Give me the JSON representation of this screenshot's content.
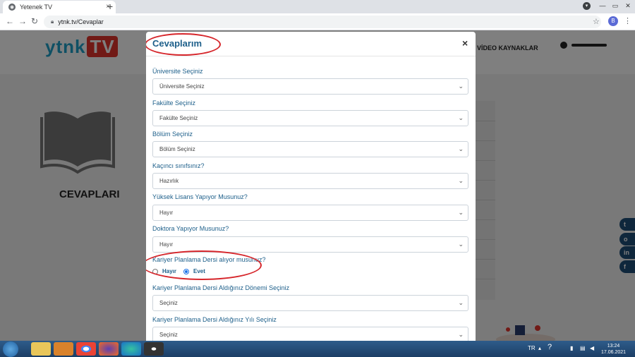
{
  "browser": {
    "tab_title": "Yetenek TV",
    "new_tab": "+",
    "tab_close": "×",
    "url": "ytnk.tv/Cevaplar",
    "profile_initial": "B",
    "window_min": "—",
    "window_max": "▭",
    "window_close": "✕"
  },
  "site": {
    "logo_part1": "ytnk",
    "logo_part2": "TV",
    "nav_video": "VİDEO KAYNAKLAR",
    "section_title": "CEVAPLARI",
    "social": [
      "t",
      "o",
      "in",
      "f"
    ]
  },
  "modal": {
    "title": "Cevaplarım",
    "close": "×",
    "fields": [
      {
        "label": "Üniversite Seçiniz",
        "value": "Üniversite Seçiniz"
      },
      {
        "label": "Fakülte Seçiniz",
        "value": "Fakülte Seçiniz"
      },
      {
        "label": "Bölüm Seçiniz",
        "value": "Bölüm Seçiniz"
      },
      {
        "label": "Kaçıncı sınıfsınız?",
        "value": "Hazırlık"
      },
      {
        "label": "Yüksek Lisans Yapıyor Musunuz?",
        "value": "Hayır"
      },
      {
        "label": "Doktora Yapıyor Musunuz?",
        "value": "Hayır"
      }
    ],
    "radio_question": "Kariyer Planlama Dersi alıyor musunuz?",
    "radio_no": "Hayır",
    "radio_yes": "Evet",
    "radio_selected": "Evet",
    "fields2": [
      {
        "label": "Kariyer Planlama Dersi Aldığınız Dönemi Seçiniz",
        "value": "Seçiniz"
      },
      {
        "label": "Kariyer Planlama Dersi Aldığınız Yılı Seçiniz",
        "value": "Seçiniz"
      }
    ]
  },
  "taskbar": {
    "lang": "TR",
    "time": "13:24",
    "date": "17.06.2021"
  },
  "colors": {
    "accent": "#1d5f8a",
    "highlight": "#d6262b"
  }
}
